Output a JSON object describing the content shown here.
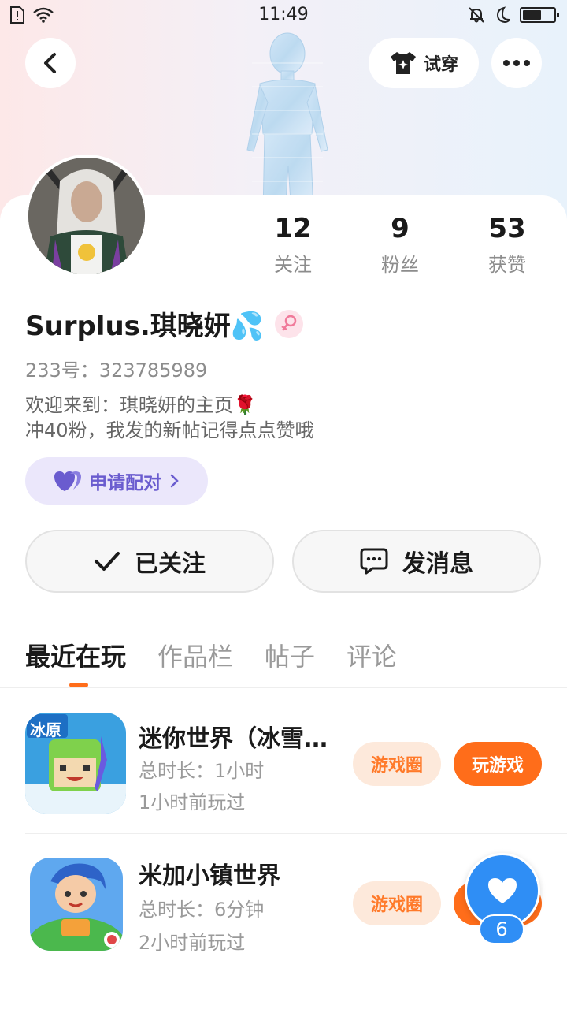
{
  "status_bar": {
    "time": "11:49",
    "battery_level": 0.55
  },
  "header": {
    "try_on_label": "试穿"
  },
  "profile": {
    "nickname": "Surplus.琪晓妍💦",
    "uid": "233号：323785989",
    "bio_line1": "欢迎来到：琪晓妍的主页🌹",
    "bio_line2": "冲40粉，我发的新帖记得点点赞哦",
    "pair_label": "申请配对",
    "stats": [
      {
        "value": "12",
        "label": "关注"
      },
      {
        "value": "9",
        "label": "粉丝"
      },
      {
        "value": "53",
        "label": "获赞"
      }
    ]
  },
  "actions": {
    "follow_label": "已关注",
    "message_label": "发消息"
  },
  "tabs": [
    {
      "label": "最近在玩",
      "active": true
    },
    {
      "label": "作品栏",
      "active": false
    },
    {
      "label": "帖子",
      "active": false
    },
    {
      "label": "评论",
      "active": false
    }
  ],
  "games": [
    {
      "title": "迷你世界（冰雪…",
      "duration": "总时长：1小时",
      "last_played": "1小时前玩过",
      "circle_label": "游戏圈",
      "play_label": "玩游戏",
      "icon_text": "冰原"
    },
    {
      "title": "米加小镇世界",
      "duration": "总时长：6分钟",
      "last_played": "2小时前玩过",
      "circle_label": "游戏圈",
      "play_label": "玩游戏"
    }
  ],
  "like_fab": {
    "count": "6"
  },
  "colors": {
    "accent": "#ff6d1a",
    "pair": "#6a5ccf",
    "fab": "#2f8ef5"
  }
}
